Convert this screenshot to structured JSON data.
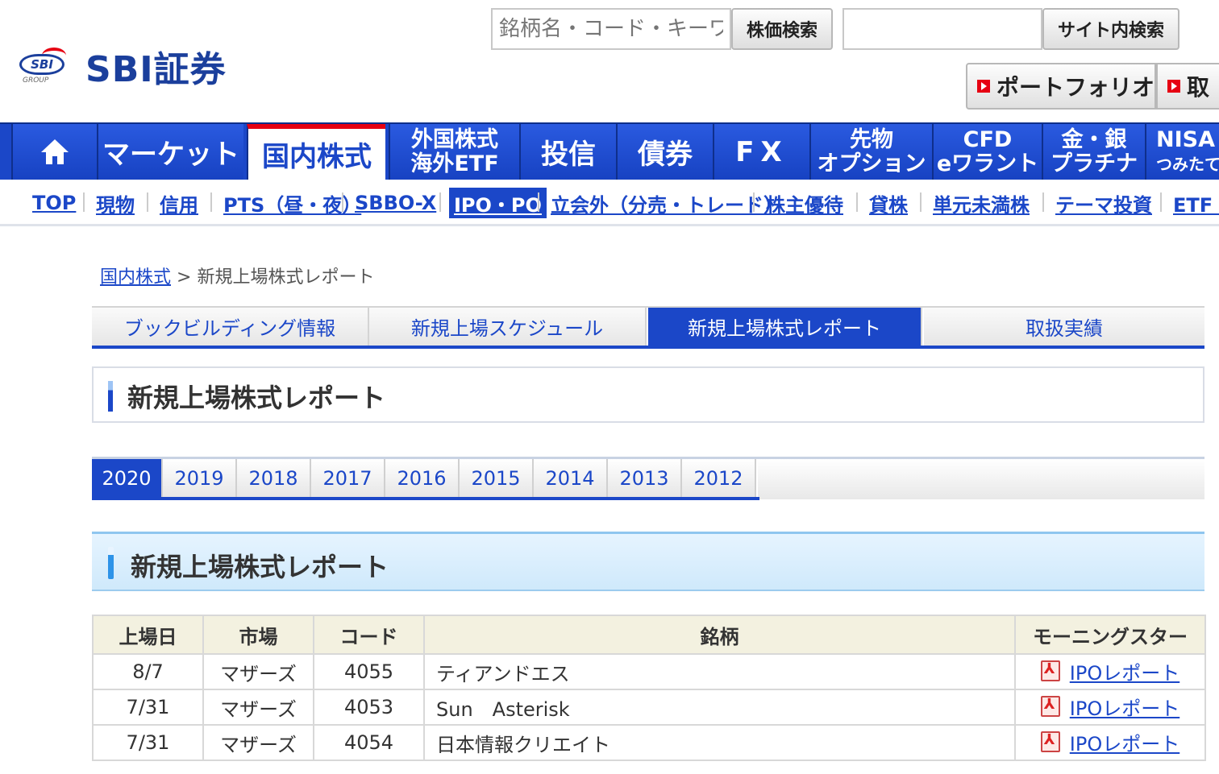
{
  "header": {
    "logo_badge": "SBI",
    "logo_group": "GROUP",
    "logo_text": "SBI証券",
    "stock_search_placeholder": "銘柄名・コード・キーワード",
    "stock_search_button": "株価検索",
    "site_search_placeholder": "",
    "site_search_button": "サイト内検索",
    "portfolio_button": "ポートフォリオ",
    "trade_button": "取"
  },
  "global_nav": {
    "home": "home-icon",
    "items": [
      {
        "label": "マーケット"
      },
      {
        "label": "国内株式"
      },
      {
        "label_line1": "外国株式",
        "label_line2": "海外ETF"
      },
      {
        "label": "投信"
      },
      {
        "label": "債券"
      },
      {
        "label": "FX"
      },
      {
        "label_line1": "先物",
        "label_line2": "オプション"
      },
      {
        "label_line1": "CFD",
        "label_line2": "eワラント"
      },
      {
        "label_line1": "金・銀",
        "label_line2": "プラチナ"
      },
      {
        "label_line1": "NISA",
        "label_line2": "つみたてN"
      }
    ]
  },
  "sub_nav": [
    "TOP",
    "現物",
    "信用",
    "PTS（昼・夜）",
    "SBBO-X",
    "IPO・PO",
    "立会外（分売・トレード）",
    "株主優待",
    "貸株",
    "単元未満株",
    "テーマ投資",
    "ETF・"
  ],
  "breadcrumb": {
    "link": "国内株式",
    "separator": " > ",
    "current": "新規上場株式レポート"
  },
  "tabs": [
    "ブックビルディング情報",
    "新規上場スケジュール",
    "新規上場株式レポート",
    "取扱実績"
  ],
  "page_heading": "新規上場株式レポート",
  "years": [
    "2020",
    "2019",
    "2018",
    "2017",
    "2016",
    "2015",
    "2014",
    "2013",
    "2012"
  ],
  "section_heading": "新規上場株式レポート",
  "table": {
    "headers": [
      "上場日",
      "市場",
      "コード",
      "銘柄",
      "モーニングスター"
    ],
    "rows": [
      {
        "date": "8/7",
        "market": "マザーズ",
        "code": "4055",
        "name": "ティアンドエス",
        "report": "IPOレポート"
      },
      {
        "date": "7/31",
        "market": "マザーズ",
        "code": "4053",
        "name": "Sun　Asterisk",
        "report": "IPOレポート"
      },
      {
        "date": "7/31",
        "market": "マザーズ",
        "code": "4054",
        "name": "日本情報クリエイト",
        "report": "IPOレポート"
      }
    ]
  },
  "colors": {
    "brand_blue": "#1b47c8",
    "accent_red": "#e60012"
  }
}
